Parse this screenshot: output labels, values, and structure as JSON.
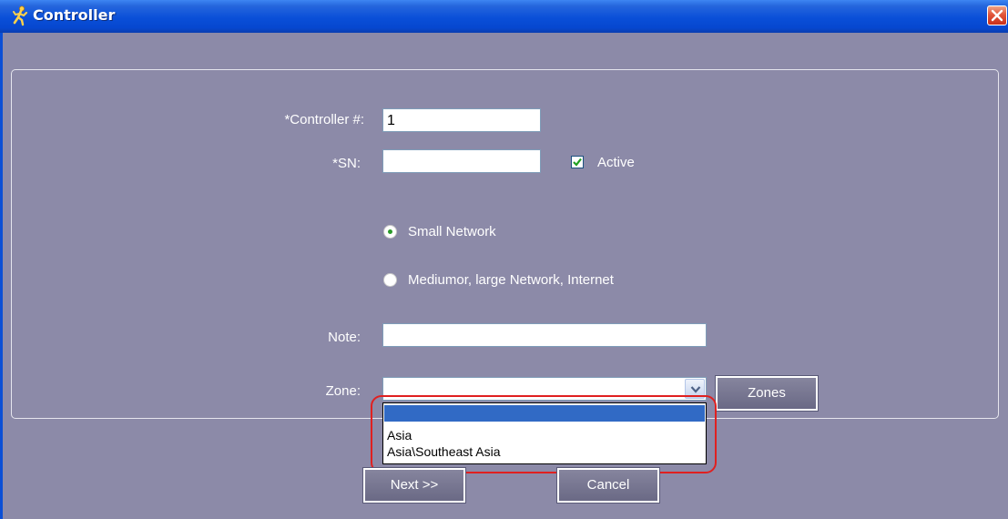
{
  "window": {
    "title": "Controller",
    "app_icon": "runner-icon",
    "close_icon": "close-icon"
  },
  "form": {
    "controller_number": {
      "label": "*Controller #:",
      "value": "1"
    },
    "sn": {
      "label": "*SN:",
      "value": ""
    },
    "active": {
      "label": "Active",
      "checked": true
    },
    "network_options": [
      {
        "label": "Small Network",
        "selected": true
      },
      {
        "label": "Mediumor, large Network, Internet",
        "selected": false
      }
    ],
    "note": {
      "label": "Note:",
      "value": ""
    },
    "zone": {
      "label": "Zone:",
      "value": "",
      "open": true,
      "options": [
        "",
        "Asia",
        "Asia\\Southeast Asia"
      ],
      "selected_index": 0
    },
    "zones_button": "Zones"
  },
  "footer": {
    "next_button": "Next >>",
    "cancel_button": "Cancel"
  },
  "colors": {
    "title_bar": "#0a4fd8",
    "body_bg": "#8c8aa8",
    "selection": "#316ac5",
    "highlight": "#e02020"
  }
}
